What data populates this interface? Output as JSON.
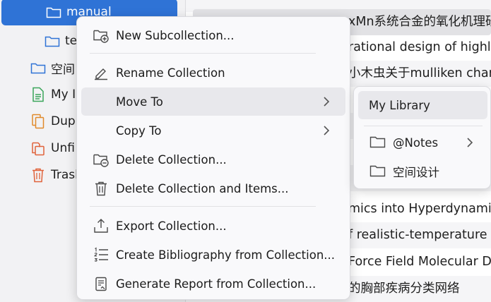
{
  "colors": {
    "selection_blue": "#2f73d6",
    "folder_blue": "#2f73d6",
    "note_green": "#3aa55a",
    "orange": "#e08a2b",
    "red_orange": "#e0623a"
  },
  "sidebar": {
    "items": [
      {
        "label": "manual",
        "icon": "folder-icon"
      },
      {
        "label": "te",
        "icon": "folder-icon"
      },
      {
        "label": "空间",
        "icon": "folder-icon"
      },
      {
        "label": "My I",
        "icon": "document-icon"
      },
      {
        "label": "Dup",
        "icon": "duplicate-icon"
      },
      {
        "label": "Unfi",
        "icon": "unfiled-icon"
      },
      {
        "label": "Trasl",
        "icon": "trash-icon"
      }
    ]
  },
  "list": {
    "rows": [
      "",
      "xMn系统合金的氧化机理研",
      "rational design of highl",
      "小木虫关于mulliken charg",
      "",
      "",
      "",
      "",
      "mics into Hyperdynamics",
      "f realistic-temperature f",
      "Force Field Molecular D",
      "的胸部疾病分类网络"
    ]
  },
  "context_menu": {
    "new_subcollection": "New Subcollection...",
    "rename": "Rename Collection",
    "move_to": "Move To",
    "copy_to": "Copy To",
    "delete": "Delete Collection...",
    "delete_items": "Delete Collection and Items...",
    "export": "Export Collection...",
    "bibliography": "Create Bibliography from Collection...",
    "report": "Generate Report from Collection..."
  },
  "submenu": {
    "my_library": "My Library",
    "notes": "@Notes",
    "space_design": "空间设计"
  }
}
